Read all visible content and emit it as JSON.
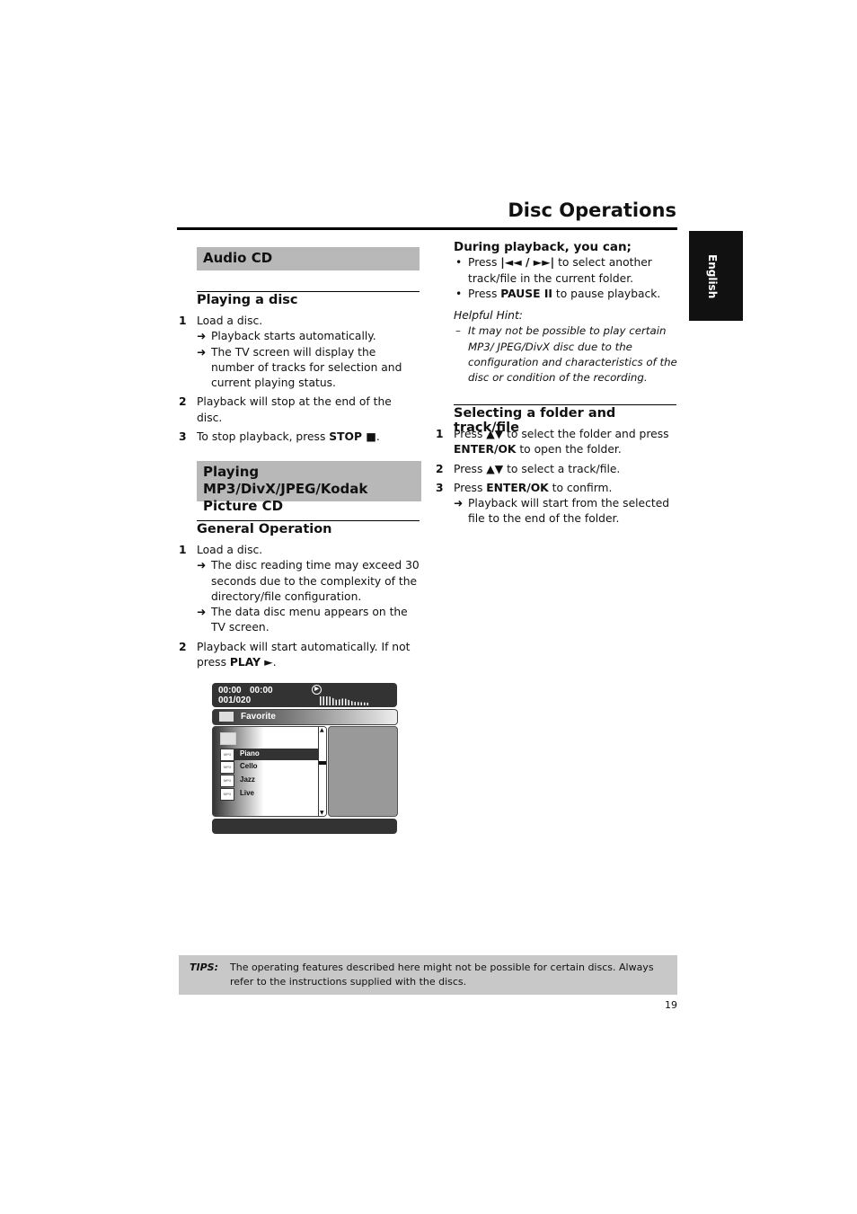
{
  "header": {
    "title": "Disc Operations",
    "language_tab": "English"
  },
  "left": {
    "audio_cd": {
      "bar": "Audio CD",
      "subhead": "Playing a disc",
      "steps": [
        {
          "n": "1",
          "text": "Load a disc.",
          "arrows": [
            "Playback starts automatically.",
            "The TV screen will display the number of tracks for selection and current playing status."
          ]
        },
        {
          "n": "2",
          "text": "Playback will stop at the end of the disc."
        },
        {
          "n": "3",
          "pre": "To stop playback, press ",
          "bold": "STOP ■",
          "post": "."
        }
      ]
    },
    "mp3": {
      "bar": "Playing MP3/DivX/JPEG/Kodak Picture CD",
      "subhead": "General Operation",
      "steps": [
        {
          "n": "1",
          "text": "Load a disc.",
          "arrows": [
            "The disc reading time may exceed 30 seconds due to the complexity of the directory/file configuration.",
            "The data disc menu appears on the TV screen."
          ]
        },
        {
          "n": "2",
          "pre": "Playback will start automatically. If not press ",
          "bold": "PLAY ►",
          "post": "."
        }
      ]
    }
  },
  "tv_screen": {
    "time_elapsed": "00:00",
    "time_total": "00:00",
    "track_counter": "001/020",
    "folder": "Favorite",
    "files": [
      {
        "type": "MP3",
        "name": "Piano",
        "selected": true
      },
      {
        "type": "MP3",
        "name": "Cello"
      },
      {
        "type": "MP3",
        "name": "Jazz"
      },
      {
        "type": "MP3",
        "name": "Live"
      }
    ],
    "icons": [
      "play-icon",
      "level-meter-icon",
      "folder-icon",
      "scroll-up-icon",
      "scroll-down-icon"
    ]
  },
  "right": {
    "during": {
      "heading": "During playback, you can;",
      "bullets": [
        {
          "pre": "Press ",
          "bold": "|◄◄ / ►►|",
          "post": " to select another track/file in the current folder."
        },
        {
          "pre": "Press ",
          "bold": "PAUSE II",
          "post": " to pause playback."
        }
      ]
    },
    "hint": {
      "title": "Helpful Hint:",
      "text": "It may not be possible to play certain MP3/ JPEG/DivX disc due to the configuration and characteristics of the disc or condition of the recording."
    },
    "select": {
      "subhead": "Selecting a folder and track/file",
      "steps": [
        {
          "n": "1",
          "pre": "Press ",
          "bold": "▲▼",
          "post": " to select the folder and press ",
          "bold2": "ENTER/OK",
          "post2": " to open the folder."
        },
        {
          "n": "2",
          "pre": "Press ",
          "bold": "▲▼",
          "post": " to select a track/file."
        },
        {
          "n": "3",
          "pre": "Press ",
          "bold": "ENTER/OK",
          "post": " to confirm.",
          "arrows": [
            "Playback will start from the selected file to the end of the folder."
          ]
        }
      ]
    }
  },
  "tips": {
    "label": "TIPS:",
    "text": "The operating features described here might not be possible for certain discs. Always refer to the instructions supplied with the discs."
  },
  "page_number": "19"
}
